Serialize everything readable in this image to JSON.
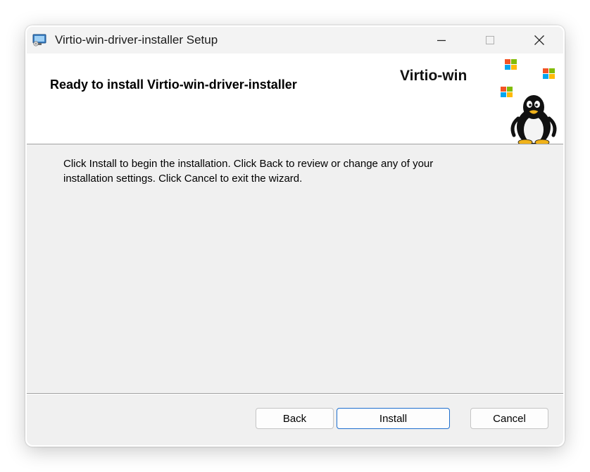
{
  "window": {
    "title": "Virtio-win-driver-installer Setup"
  },
  "header": {
    "title": "Ready to install Virtio-win-driver-installer",
    "brand": "Virtio-win"
  },
  "body": {
    "text_line1": "Click Install to begin the installation. Click Back to review or change any of your",
    "text_line2": "installation settings. Click Cancel to exit the wizard."
  },
  "buttons": {
    "back": "Back",
    "install": "Install",
    "cancel": "Cancel"
  },
  "colors": {
    "accent": "#1f6fcf",
    "window_bg": "#f0f0f0"
  }
}
